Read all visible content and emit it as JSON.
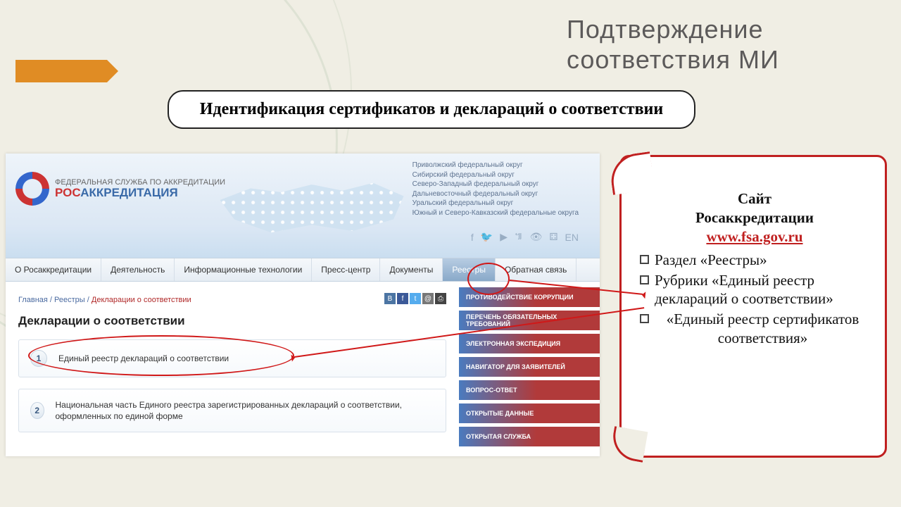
{
  "slide": {
    "title_line1": "Подтверждение",
    "title_line2": "соответствия МИ",
    "subtitle": "Идентификация сертификатов и деклараций о соответствии"
  },
  "logo": {
    "small": "ФЕДЕРАЛЬНАЯ СЛУЖБА ПО АККРЕДИТАЦИИ",
    "brand_red": "РОС",
    "brand_blue": "АККРЕДИТАЦИЯ"
  },
  "districts": [
    "Приволжский федеральный округ",
    "Сибирский федеральный округ",
    "Северо-Западный федеральный округ",
    "Дальневосточный федеральный округ",
    "Уральский федеральный округ",
    "Южный и Северо-Кавказский федеральные округа"
  ],
  "social_lang": "EN",
  "nav": {
    "items": [
      "О Росаккредитации",
      "Деятельность",
      "Информационные технологии",
      "Пресс-центр",
      "Документы",
      "Реестры",
      "Обратная связь"
    ],
    "active_index": 5
  },
  "breadcrumb": {
    "a": "Главная",
    "b": "Реестры",
    "c": "Декларации о соответствии"
  },
  "page_title": "Декларации о соответствии",
  "registry_items": [
    {
      "n": "1",
      "text": "Единый реестр деклараций о соответствии"
    },
    {
      "n": "2",
      "text": "Национальная часть Единого реестра зарегистрированных деклараций о соответствии, оформленных по единой форме"
    }
  ],
  "side_buttons": [
    "ПРОТИВОДЕЙСТВИЕ КОРРУПЦИИ",
    "ПЕРЕЧЕНЬ ОБЯЗАТЕЛЬНЫХ ТРЕБОВАНИЙ",
    "ЭЛЕКТРОННАЯ ЭКСПЕДИЦИЯ",
    "НАВИГАТОР ДЛЯ ЗАЯВИТЕЛЕЙ",
    "ВОПРОС-ОТВЕТ",
    "ОТКРЫТЫЕ ДАННЫЕ",
    "ОТКРЫТАЯ СЛУЖБА"
  ],
  "info_card": {
    "line1": "Сайт",
    "line2": "Росаккредитации",
    "link": "www.fsa.gov.ru",
    "bullets": [
      "Раздел «Реестры»",
      "Рубрики «Единый реестр деклараций о соответствии»",
      "«Единый реестр сертификатов соответствия»"
    ]
  }
}
